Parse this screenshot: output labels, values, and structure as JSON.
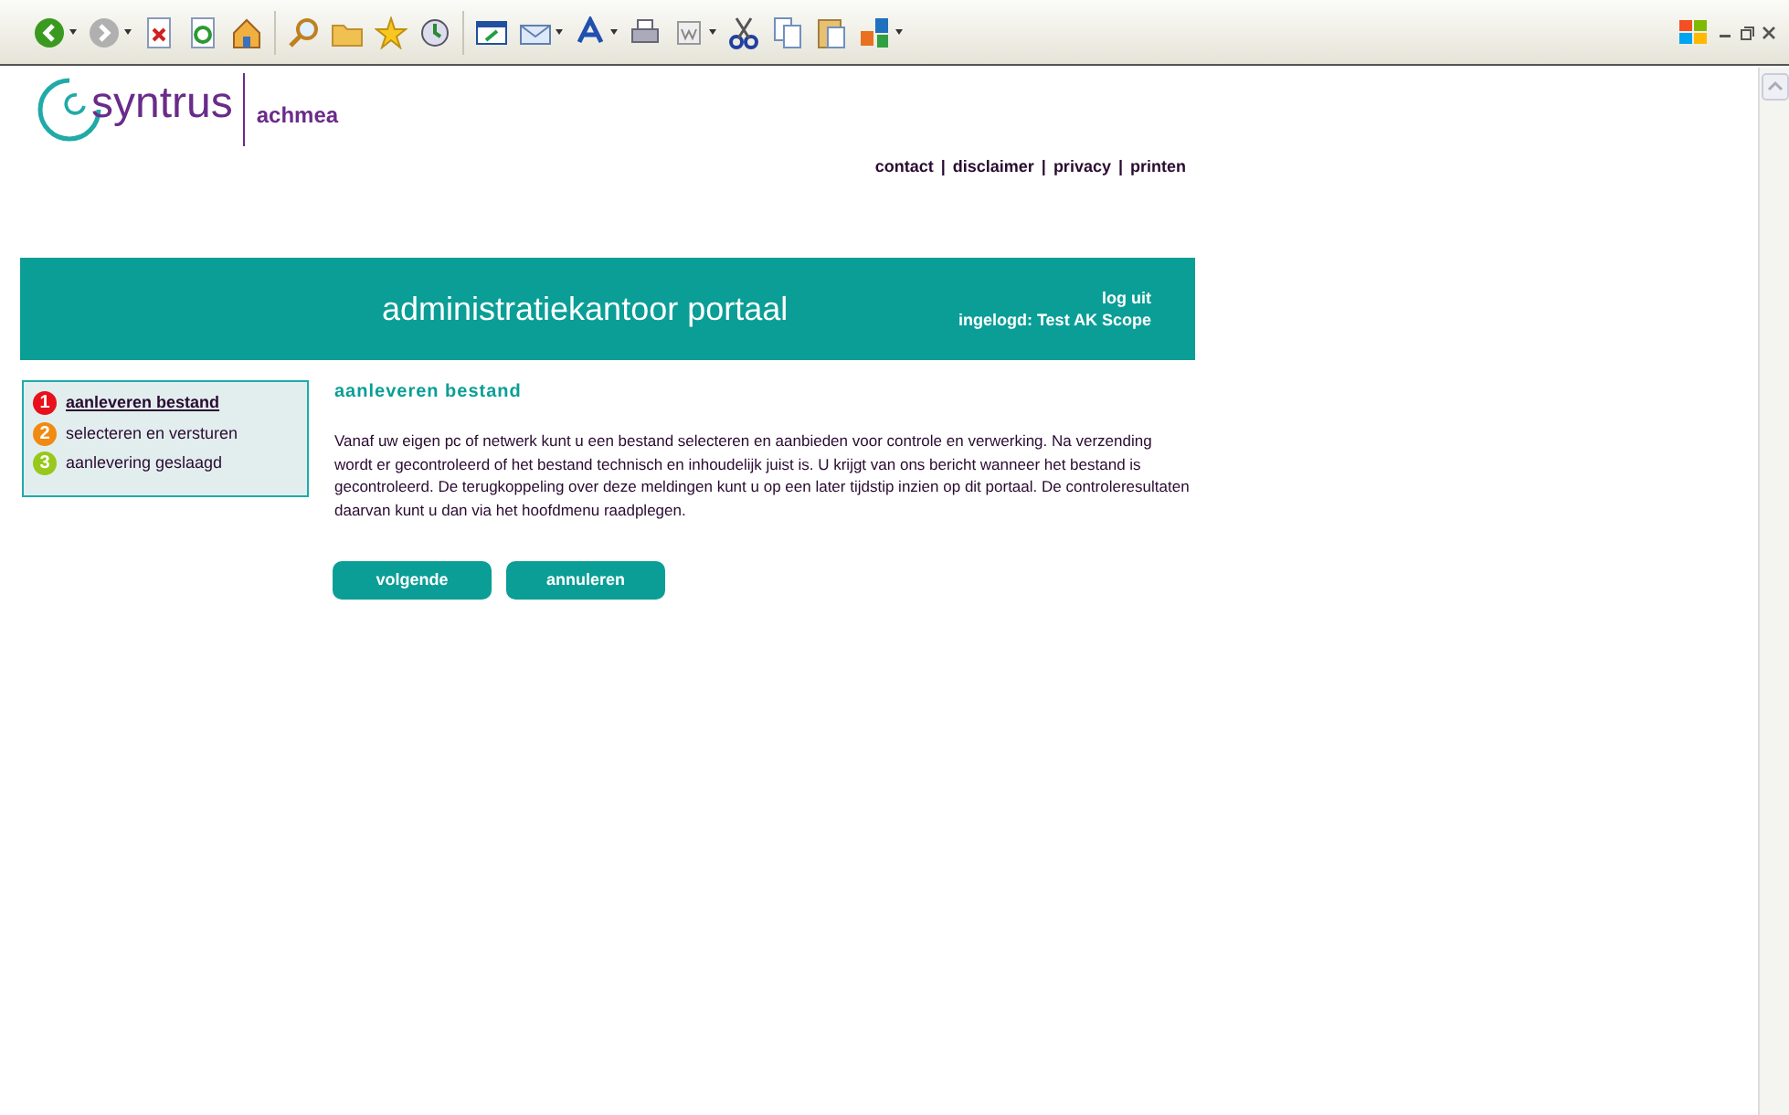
{
  "brand": {
    "name": "syntrus",
    "partner": "achmea"
  },
  "top_links": [
    {
      "label": "contact",
      "separator": "|"
    },
    {
      "label": "disclaimer",
      "separator": "|"
    },
    {
      "label": "privacy",
      "separator": "|"
    },
    {
      "label": "printen"
    }
  ],
  "banner": {
    "title": "administratiekantoor portaal",
    "logout": "log uit",
    "logged_in": "ingelogd: Test AK Scope"
  },
  "steps": [
    {
      "number": "1",
      "label": "aanleveren bestand",
      "color": "#e8101a",
      "selected": true
    },
    {
      "number": "2",
      "label": "selecteren en versturen",
      "color": "#f08a10",
      "selected": false
    },
    {
      "number": "3",
      "label": "aanlevering geslaagd",
      "color": "#98c81a",
      "selected": false
    }
  ],
  "content": {
    "heading": "aanleveren bestand",
    "paragraph": "Vanaf uw eigen pc of netwerk kunt u een bestand selecteren en aanbieden voor controle en verwerking. Na verzending wordt er gecontroleerd of het bestand technisch en inhoudelijk juist is. U krijgt van ons bericht wanneer het bestand is gecontroleerd. De terugkoppeling over deze meldingen kunt u op een later tijdstip inzien op dit portaal. De controleresultaten daarvan kunt u dan via het hoofdmenu raadplegen."
  },
  "buttons": [
    {
      "label": "volgende"
    },
    {
      "label": "annuleren"
    }
  ]
}
